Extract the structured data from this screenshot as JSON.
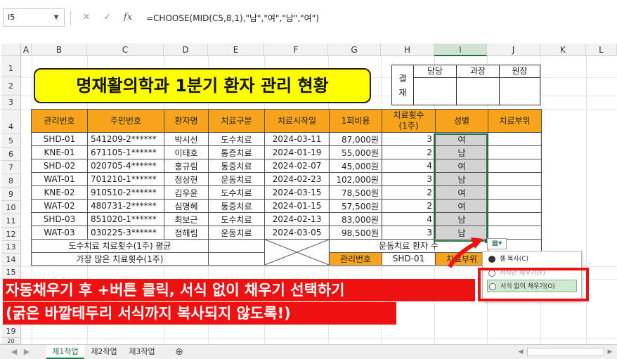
{
  "formula_bar": {
    "name_box": "I5",
    "cancel_icon": "✕",
    "enter_icon": "✓",
    "fx_icon": "fx",
    "formula": "=CHOOSE(MID(C5,8,1),\"남\",\"여\",\"남\",\"여\")"
  },
  "columns": [
    "A",
    "B",
    "C",
    "D",
    "E",
    "F",
    "G",
    "H",
    "I",
    "J",
    "K",
    "L"
  ],
  "rows": [
    "1",
    "2",
    "3",
    "4",
    "5",
    "6",
    "7",
    "8",
    "9",
    "10",
    "11",
    "12",
    "13",
    "14",
    "15",
    "",
    "",
    "",
    "19",
    "20"
  ],
  "title": "명재활의학과 1분기 환자 관리 현황",
  "approval": {
    "label_top": "결",
    "label_bottom": "재",
    "headers": [
      "담당",
      "과장",
      "원장"
    ]
  },
  "table": {
    "headers": [
      "관리번호",
      "주민번호",
      "환자명",
      "치료구분",
      "치료시작일",
      "1회비용",
      "치료횟수\n(1주)",
      "성별",
      "치료부위"
    ],
    "rows": [
      [
        "SHD-01",
        "541209-2******",
        "박시선",
        "도수치료",
        "2024-03-11",
        "87,000원",
        "3",
        "여",
        ""
      ],
      [
        "KNE-01",
        "671105-1******",
        "이태호",
        "통증치료",
        "2024-01-19",
        "55,000원",
        "2",
        "남",
        ""
      ],
      [
        "SHD-02",
        "020705-4******",
        "홍규림",
        "통증치료",
        "2024-02-07",
        "45,000원",
        "4",
        "여",
        ""
      ],
      [
        "WAT-01",
        "701210-1******",
        "정상현",
        "운동치료",
        "2024-02-23",
        "102,000원",
        "3",
        "남",
        ""
      ],
      [
        "KNE-02",
        "910510-2******",
        "김우윤",
        "도수치료",
        "2024-03-15",
        "78,500원",
        "2",
        "여",
        ""
      ],
      [
        "WAT-02",
        "480731-2******",
        "심명혜",
        "통증치료",
        "2024-01-15",
        "57,500원",
        "2",
        "여",
        ""
      ],
      [
        "SHD-03",
        "851020-1******",
        "최보근",
        "도수치료",
        "2024-02-13",
        "83,000원",
        "4",
        "남",
        ""
      ],
      [
        "WAT-03",
        "030225-3******",
        "정해림",
        "운동치료",
        "2024-03-05",
        "98,500원",
        "3",
        "남",
        ""
      ]
    ],
    "footer": {
      "avg_label": "도수치료 치료횟수(1주) 평균",
      "max_label": "가장 많은 치료횟수(1주)",
      "exercise_label": "운동치료 환자 수",
      "mgmt_label": "관리번호",
      "mgmt_value": "SHD-01",
      "part_label": "치료부위"
    }
  },
  "paste_options": {
    "icon": "자동 채우기 옵션",
    "items": [
      "셀 복사(C)",
      "서식만 채우기(F)",
      "서식 없이 채우기(O)"
    ]
  },
  "captions": {
    "line1": "자동채우기 후 +버튼 클릭, 서식 없이 채우기 선택하기",
    "line2": "(굵은 바깥테두리 서식까지 복사되지 않도록!)"
  },
  "sheet_tabs": [
    "제1작업",
    "제2작업",
    "제3작업"
  ],
  "add_sheet_icon": "⊕",
  "colors": {
    "header_orange": "#f8a41c",
    "title_yellow": "#ffff00",
    "accent_red": "#ee1111",
    "excel_green": "#217346"
  }
}
